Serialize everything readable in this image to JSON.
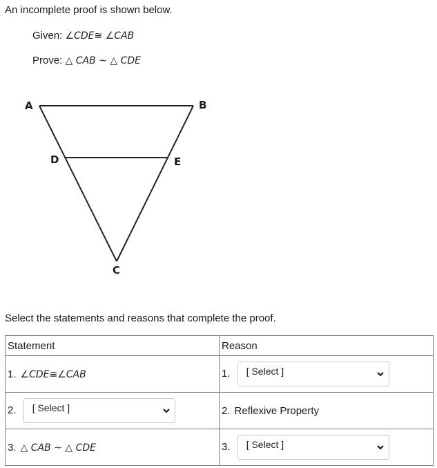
{
  "intro": "An incomplete proof is shown below.",
  "given": {
    "label": "Given:",
    "angle1": "CDE",
    "congruent": "≅",
    "angle2": "CAB",
    "angle_symbol": "∠"
  },
  "prove": {
    "label": "Prove:",
    "tri1": "CAB",
    "similar": "~",
    "tri2": "CDE",
    "triangle_symbol": "△"
  },
  "figure": {
    "points": {
      "A": "A",
      "B": "B",
      "C": "C",
      "D": "D",
      "E": "E"
    },
    "segments": [
      "AB",
      "DE",
      "AC",
      "BC"
    ]
  },
  "instruction": "Select the statements and reasons that complete the proof.",
  "table": {
    "headers": {
      "statement": "Statement",
      "reason": "Reason"
    },
    "rows": [
      {
        "statement_num": "1.",
        "statement": {
          "type": "text",
          "angle_symbol": "∠",
          "a": "CDE",
          "rel": "≅",
          "b": "CAB"
        },
        "reason_num": "1.",
        "reason": {
          "type": "select",
          "value": "[ Select ]"
        }
      },
      {
        "statement_num": "2.",
        "statement": {
          "type": "select",
          "value": "[ Select ]"
        },
        "reason_num": "2.",
        "reason": {
          "type": "text",
          "value": "Reflexive Property"
        }
      },
      {
        "statement_num": "3.",
        "statement": {
          "type": "text",
          "triangle_symbol": "△",
          "a": "CAB",
          "rel": "~",
          "b": "CDE"
        },
        "reason_num": "3.",
        "reason": {
          "type": "select",
          "value": "[ Select ]"
        }
      }
    ]
  },
  "icons": {
    "dropdown": "chevron-down-icon"
  }
}
